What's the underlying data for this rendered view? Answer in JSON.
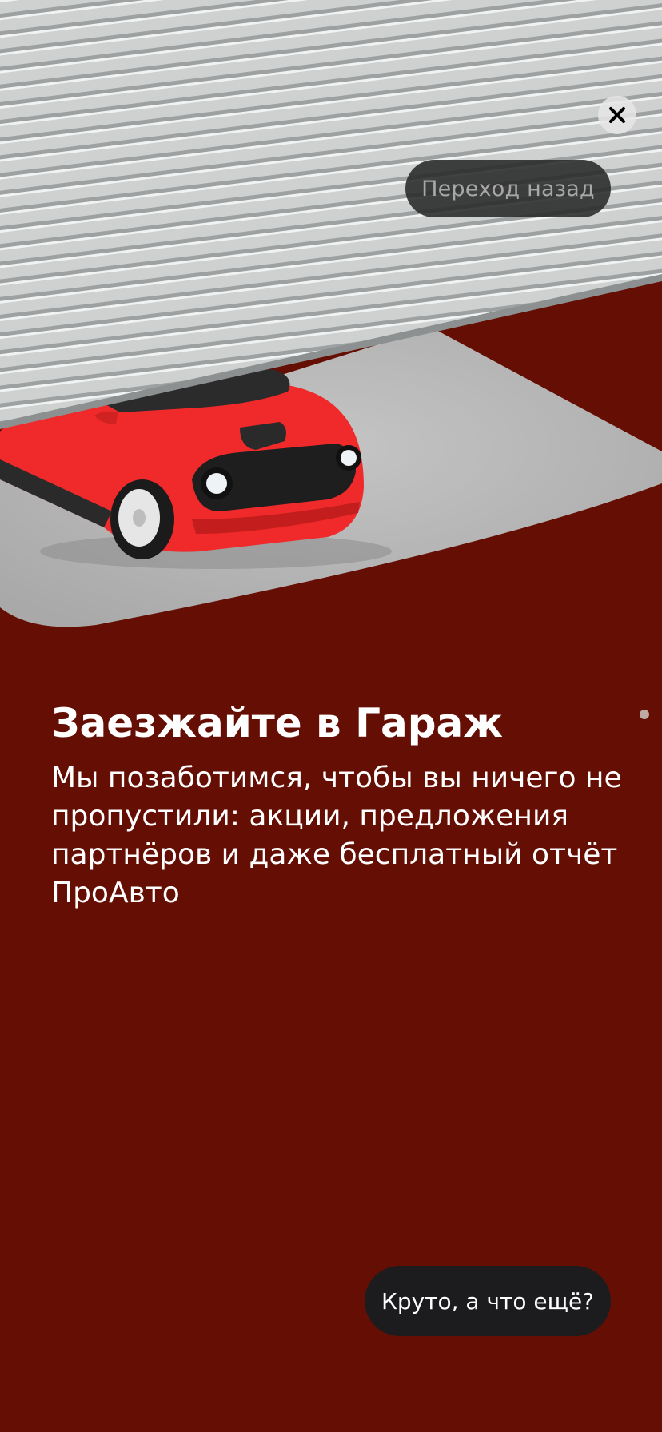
{
  "onboarding": {
    "title": "Заезжайте в Гараж",
    "description": "Мы позаботимся, чтобы вы ничего не пропустили: акции, предложения партнёров и даже бесплатный отчёт ПроАвто",
    "next_button_label": "Круто, а что ещё?",
    "back_hint_label": "Переход назад",
    "close_icon": "close-icon",
    "illustration": "garage-car-illustration"
  },
  "colors": {
    "background": "#640e04",
    "button_background": "#1c1c1e",
    "car_body": "#f02a2a",
    "garage_door": "#cfd1d1",
    "floor": "#b9b9b9"
  }
}
